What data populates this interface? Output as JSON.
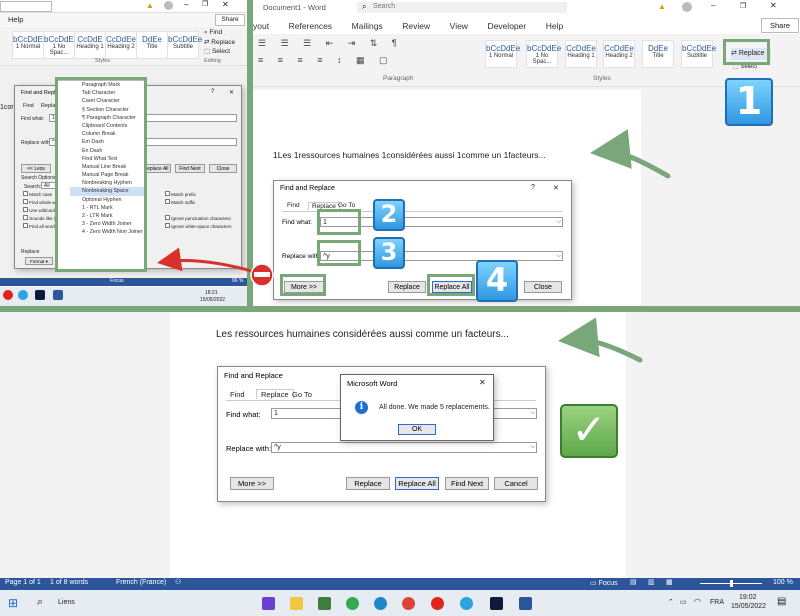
{
  "top_left": {
    "help_tab": "Help",
    "share": "Share",
    "styles": [
      "1 Normal",
      "1 No Spac...",
      "Heading 1",
      "Heading 2",
      "Title",
      "Subtitle"
    ],
    "style_samples": [
      "bCcDdEe",
      "bCcDdEe",
      "CcDdE",
      "CcDdEe",
      "DdEe",
      "bCcDdEe"
    ],
    "editing_items": [
      "Find",
      "Replace",
      "Select"
    ],
    "editing_label": "Editing",
    "styles_label": "Styles",
    "dialog_title": "Find and Replace",
    "tabs": [
      "Find",
      "Replace"
    ],
    "find_what_label": "Find what:",
    "find_what_value": "1",
    "replace_with_label": "Replace with:",
    "replace_with_value": "^y",
    "less_button": "<< Less",
    "replace_all": "Replace All",
    "find_next": "Find Next",
    "close": "Close",
    "search_options": "Search Options",
    "search_label": "Search:",
    "search_value": "All",
    "options_left": [
      "Match case",
      "Find whole words only",
      "Use wildcards",
      "Sounds like (English)",
      "Find all word forms (English)"
    ],
    "options_right": [
      "Match prefix",
      "Match suffix",
      "Ignore punctuation characters",
      "Ignore white-space characters"
    ],
    "replace_section": "Replace",
    "format_button": "Format ▾",
    "special_button": "Special ▾",
    "no_formatting": "No Formatting",
    "special_menu": [
      "Paragraph Mark",
      "Tab Character",
      "Caret Character",
      "§ Section Character",
      "¶ Paragraph Character",
      "Clipboard Contents",
      "Column Break",
      "Em Dash",
      "En Dash",
      "Find What Text",
      "Manual Line Break",
      "Manual Page Break",
      "Nonbreaking Hyphen",
      "Nonbreaking Space",
      "Optional Hyphen",
      "1 - RTL Mark",
      "2 - LTR Mark",
      "3 - Zero Width Joiner",
      "4 - Zero Width Non Joiner"
    ],
    "special_selected_index": 13,
    "focus_label": "Focus",
    "zoom": "96 %",
    "clock_time": "18:21",
    "clock_date": "15/05/2022",
    "doc_fragment": "1cor"
  },
  "top_right": {
    "doc_title": "Document1 - Word",
    "search_placeholder": "Search",
    "tabs": [
      "yout",
      "References",
      "Mailings",
      "Review",
      "View",
      "Developer",
      "Help"
    ],
    "share": "Share",
    "paragraph_label": "Paragraph",
    "styles_label": "Styles",
    "styles": [
      "1 Normal",
      "1 No Spac...",
      "Heading 1",
      "Heading 2",
      "Title",
      "Subtitle"
    ],
    "style_samples": [
      "bCcDdEe",
      "bCcDdEe",
      "CcDdEe",
      "CcDdEe",
      "DdEe",
      "bCcDdEe"
    ],
    "replace_button": "Replace",
    "select_button": "Select",
    "document_text": "1Les 1ressources humaines 1considérées aussi 1comme un 1facteurs...",
    "dialog": {
      "title": "Find and Replace",
      "help": "?",
      "close": "✕",
      "tabs": [
        "Find",
        "Replace",
        "Go To"
      ],
      "find_what_label": "Find what:",
      "find_what_value": "1",
      "replace_with_label": "Replace with:",
      "replace_with_value": "^y",
      "more_button": "More >>",
      "replace_button": "Replace",
      "replace_all_button": "Replace All",
      "close_button": "Close"
    },
    "badges": [
      "1",
      "2",
      "3",
      "4"
    ]
  },
  "bottom": {
    "document_text": "Les ressources humaines considérées aussi comme un facteurs...",
    "dialog": {
      "title": "Find and Replace",
      "tabs": [
        "Find",
        "Replace",
        "Go To"
      ],
      "find_what_label": "Find what:",
      "find_what_value": "1",
      "replace_with_label": "Replace with:",
      "replace_with_value": "^y",
      "more_button": "More >>",
      "replace_button": "Replace",
      "replace_all_button": "Replace All",
      "find_next_button": "Find Next",
      "cancel_button": "Cancel"
    },
    "msgbox": {
      "title": "Microsoft Word",
      "close": "✕",
      "message": "All done. We made 5 replacements.",
      "ok": "OK",
      "icon": "i"
    },
    "checkmark": "✓"
  },
  "status_bar": {
    "page": "Page 1 of 1",
    "words": "1 of 8 words",
    "language": "French (France)",
    "focus": "Focus",
    "zoom": "100 %"
  },
  "taskbar": {
    "search_label": "Liens",
    "time": "19:02",
    "date": "15/05/2022",
    "lang": "FRA"
  },
  "colors": {
    "annotation_green": "#7aa77a",
    "word_blue": "#2b579a",
    "badge_blue": "#2f97e0",
    "arrow_red": "#d9302c"
  }
}
